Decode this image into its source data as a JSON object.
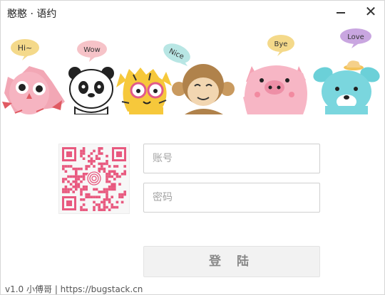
{
  "window": {
    "title": "憨憨 · 语约",
    "minimize_label": "minimize",
    "close_symbol": "✕"
  },
  "banner": {
    "bubbles": [
      "Hi~",
      "Wow",
      "Nice",
      "Bye",
      "Love"
    ]
  },
  "login": {
    "account_placeholder": "账号",
    "password_placeholder": "密码",
    "account_value": "",
    "password_value": "",
    "submit_label": "登 陆"
  },
  "footer": {
    "text": "v1.0 小傅哥 | https://bugstack.cn"
  },
  "colors": {
    "qr": "#e8597f",
    "border": "#cfcfcf"
  }
}
